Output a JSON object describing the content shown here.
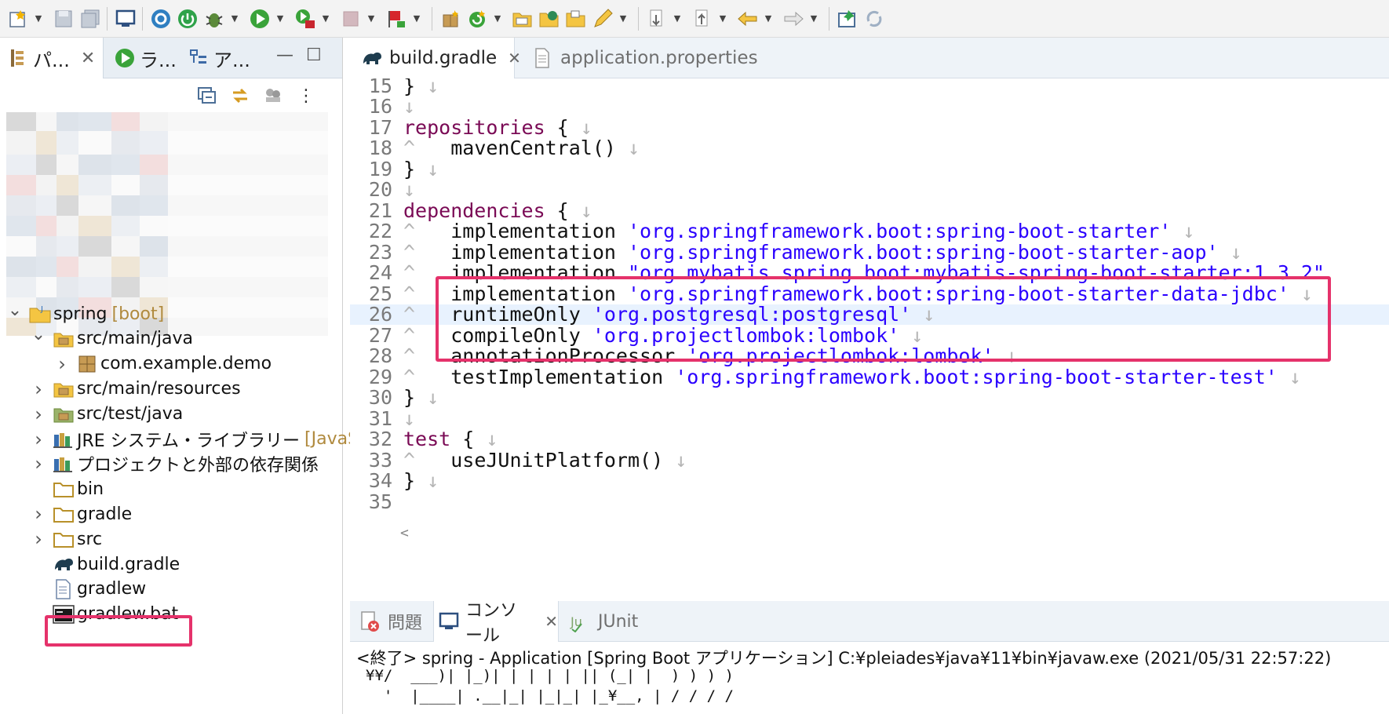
{
  "toolbar": {
    "icons": [
      "new-file-icon",
      "save-icon",
      "save-all-icon",
      "terminal-icon",
      "settings-icon",
      "power-icon",
      "debug-icon",
      "run-icon",
      "external-tool-icon",
      "stop-icon",
      "flag-icon",
      "new-package-icon",
      "refresh-icon",
      "open-folder-icon",
      "open-type-icon",
      "open-task-icon",
      "edit-icon",
      "next-annotation-icon",
      "prev-annotation-icon",
      "back-icon",
      "forward-icon",
      "pin-icon",
      "sync-icon"
    ]
  },
  "left_panel": {
    "tabs": [
      {
        "label": "パ...",
        "icon": "package-explorer-icon",
        "closable": true
      },
      {
        "label": "ラ...",
        "icon": "run-config-icon"
      },
      {
        "label": "ア...",
        "icon": "outline-icon"
      }
    ],
    "tree": [
      {
        "label": "spring",
        "decorator": "[boot]",
        "icon": "project-icon",
        "expanded": true,
        "level": 0
      },
      {
        "label": "src/main/java",
        "icon": "source-folder-icon",
        "expanded": true,
        "level": 1
      },
      {
        "label": "com.example.demo",
        "icon": "package-icon",
        "collapsed": true,
        "level": 2
      },
      {
        "label": "src/main/resources",
        "icon": "source-folder-icon",
        "collapsed": true,
        "level": 1
      },
      {
        "label": "src/test/java",
        "icon": "test-source-folder-icon",
        "collapsed": true,
        "level": 1
      },
      {
        "label": "JRE システム・ライブラリー",
        "decorator": "[JavaSE-",
        "icon": "library-icon",
        "collapsed": true,
        "level": 1
      },
      {
        "label": "プロジェクトと外部の依存関係",
        "icon": "library-icon",
        "collapsed": true,
        "level": 1
      },
      {
        "label": "bin",
        "icon": "folder-icon",
        "level": 1
      },
      {
        "label": "gradle",
        "icon": "folder-icon",
        "collapsed": true,
        "level": 1
      },
      {
        "label": "src",
        "icon": "folder-icon",
        "collapsed": true,
        "level": 1
      },
      {
        "label": "build.gradle",
        "icon": "gradle-icon",
        "level": 1,
        "highlighted": true
      },
      {
        "label": "gradlew",
        "icon": "text-file-icon",
        "level": 1
      },
      {
        "label": "gradlew.bat",
        "icon": "batch-file-icon",
        "level": 1
      }
    ]
  },
  "editor": {
    "tabs": [
      {
        "label": "build.gradle",
        "active": true,
        "icon": "gradle-icon",
        "closable": true
      },
      {
        "label": "application.properties",
        "active": false,
        "icon": "properties-file-icon"
      }
    ],
    "lines": [
      {
        "num": "15",
        "tokens": [
          {
            "t": "}",
            "c": "plain"
          },
          {
            "t": " ↓",
            "c": "ws"
          }
        ]
      },
      {
        "num": "16",
        "tokens": [
          {
            "t": "↓",
            "c": "ws"
          }
        ]
      },
      {
        "num": "17",
        "tokens": [
          {
            "t": "repositories",
            "c": "kw"
          },
          {
            "t": " {",
            "c": "plain"
          },
          {
            "t": " ↓",
            "c": "ws"
          }
        ]
      },
      {
        "num": "18",
        "tokens": [
          {
            "t": "^   ",
            "c": "ws"
          },
          {
            "t": "mavenCentral()",
            "c": "plain"
          },
          {
            "t": " ↓",
            "c": "ws"
          }
        ]
      },
      {
        "num": "19",
        "tokens": [
          {
            "t": "}",
            "c": "plain"
          },
          {
            "t": " ↓",
            "c": "ws"
          }
        ]
      },
      {
        "num": "20",
        "tokens": [
          {
            "t": "↓",
            "c": "ws"
          }
        ]
      },
      {
        "num": "21",
        "tokens": [
          {
            "t": "dependencies",
            "c": "kw"
          },
          {
            "t": " {",
            "c": "plain"
          },
          {
            "t": " ↓",
            "c": "ws"
          }
        ]
      },
      {
        "num": "22",
        "tokens": [
          {
            "t": "^   ",
            "c": "ws"
          },
          {
            "t": "implementation ",
            "c": "plain"
          },
          {
            "t": "'org.springframework.boot:spring-boot-starter'",
            "c": "str"
          },
          {
            "t": " ↓",
            "c": "ws"
          }
        ]
      },
      {
        "num": "23",
        "tokens": [
          {
            "t": "^   ",
            "c": "ws"
          },
          {
            "t": "implementation ",
            "c": "plain"
          },
          {
            "t": "'org.springframework.boot:spring-boot-starter-aop'",
            "c": "str"
          },
          {
            "t": " ↓",
            "c": "ws"
          }
        ]
      },
      {
        "num": "24",
        "tokens": [
          {
            "t": "^   ",
            "c": "ws"
          },
          {
            "t": "implementation ",
            "c": "plain"
          },
          {
            "t": "\"org.mybatis.spring.boot:mybatis-spring-boot-starter:1.3.2\"",
            "c": "str"
          }
        ]
      },
      {
        "num": "25",
        "tokens": [
          {
            "t": "^   ",
            "c": "ws"
          },
          {
            "t": "implementation ",
            "c": "plain"
          },
          {
            "t": "'org.springframework.boot:spring-boot-starter-data-jdbc'",
            "c": "str"
          },
          {
            "t": " ↓",
            "c": "ws"
          }
        ]
      },
      {
        "num": "26",
        "tokens": [
          {
            "t": "^   ",
            "c": "ws"
          },
          {
            "t": "runtimeOnly ",
            "c": "plain"
          },
          {
            "t": "'org.postgresql:postgresql'",
            "c": "str"
          },
          {
            "t": " ↓",
            "c": "ws"
          }
        ],
        "current": true
      },
      {
        "num": "27",
        "tokens": [
          {
            "t": "^   ",
            "c": "ws"
          },
          {
            "t": "compileOnly ",
            "c": "plain"
          },
          {
            "t": "'org.projectlombok:lombok'",
            "c": "str"
          },
          {
            "t": " ↓",
            "c": "ws"
          }
        ]
      },
      {
        "num": "28",
        "tokens": [
          {
            "t": "^   ",
            "c": "ws"
          },
          {
            "t": "annotationProcessor ",
            "c": "plain"
          },
          {
            "t": "'org.projectlombok:lombok'",
            "c": "str"
          },
          {
            "t": " ↓",
            "c": "ws"
          }
        ]
      },
      {
        "num": "29",
        "tokens": [
          {
            "t": "^   ",
            "c": "ws"
          },
          {
            "t": "testImplementation ",
            "c": "plain"
          },
          {
            "t": "'org.springframework.boot:spring-boot-starter-test'",
            "c": "str"
          },
          {
            "t": " ↓",
            "c": "ws"
          }
        ]
      },
      {
        "num": "30",
        "tokens": [
          {
            "t": "}",
            "c": "plain"
          },
          {
            "t": " ↓",
            "c": "ws"
          }
        ]
      },
      {
        "num": "31",
        "tokens": [
          {
            "t": "↓",
            "c": "ws"
          }
        ]
      },
      {
        "num": "32",
        "tokens": [
          {
            "t": "test",
            "c": "kw"
          },
          {
            "t": " {",
            "c": "plain"
          },
          {
            "t": " ↓",
            "c": "ws"
          }
        ]
      },
      {
        "num": "33",
        "tokens": [
          {
            "t": "^   ",
            "c": "ws"
          },
          {
            "t": "useJUnitPlatform()",
            "c": "plain"
          },
          {
            "t": " ↓",
            "c": "ws"
          }
        ]
      },
      {
        "num": "34",
        "tokens": [
          {
            "t": "}",
            "c": "plain"
          },
          {
            "t": " ↓",
            "c": "ws"
          }
        ]
      },
      {
        "num": "35",
        "tokens": []
      }
    ],
    "scroll_left_glyph": "<"
  },
  "console": {
    "tabs": [
      {
        "label": "問題",
        "icon": "problems-icon"
      },
      {
        "label": "コンソール",
        "icon": "console-icon",
        "active": true,
        "closable": true
      },
      {
        "label": "JUnit",
        "icon": "junit-icon"
      }
    ],
    "status": "<終了> spring - Application [Spring Boot アプリケーション] C:¥pleiades¥java¥11¥bin¥javaw.exe (2021/05/31 22:57:22)",
    "output_lines": [
      "¥¥/  ___)| |_)| | | | | || (_| |  ) ) ) )",
      "  '  |____| .__|_| |_|_| |_¥__, | / / / /"
    ]
  },
  "colors": {
    "highlight_border": "#e5326b",
    "keyword": "#7a0a55",
    "string": "#2a00ff",
    "current_line": "#e8f2fe"
  }
}
